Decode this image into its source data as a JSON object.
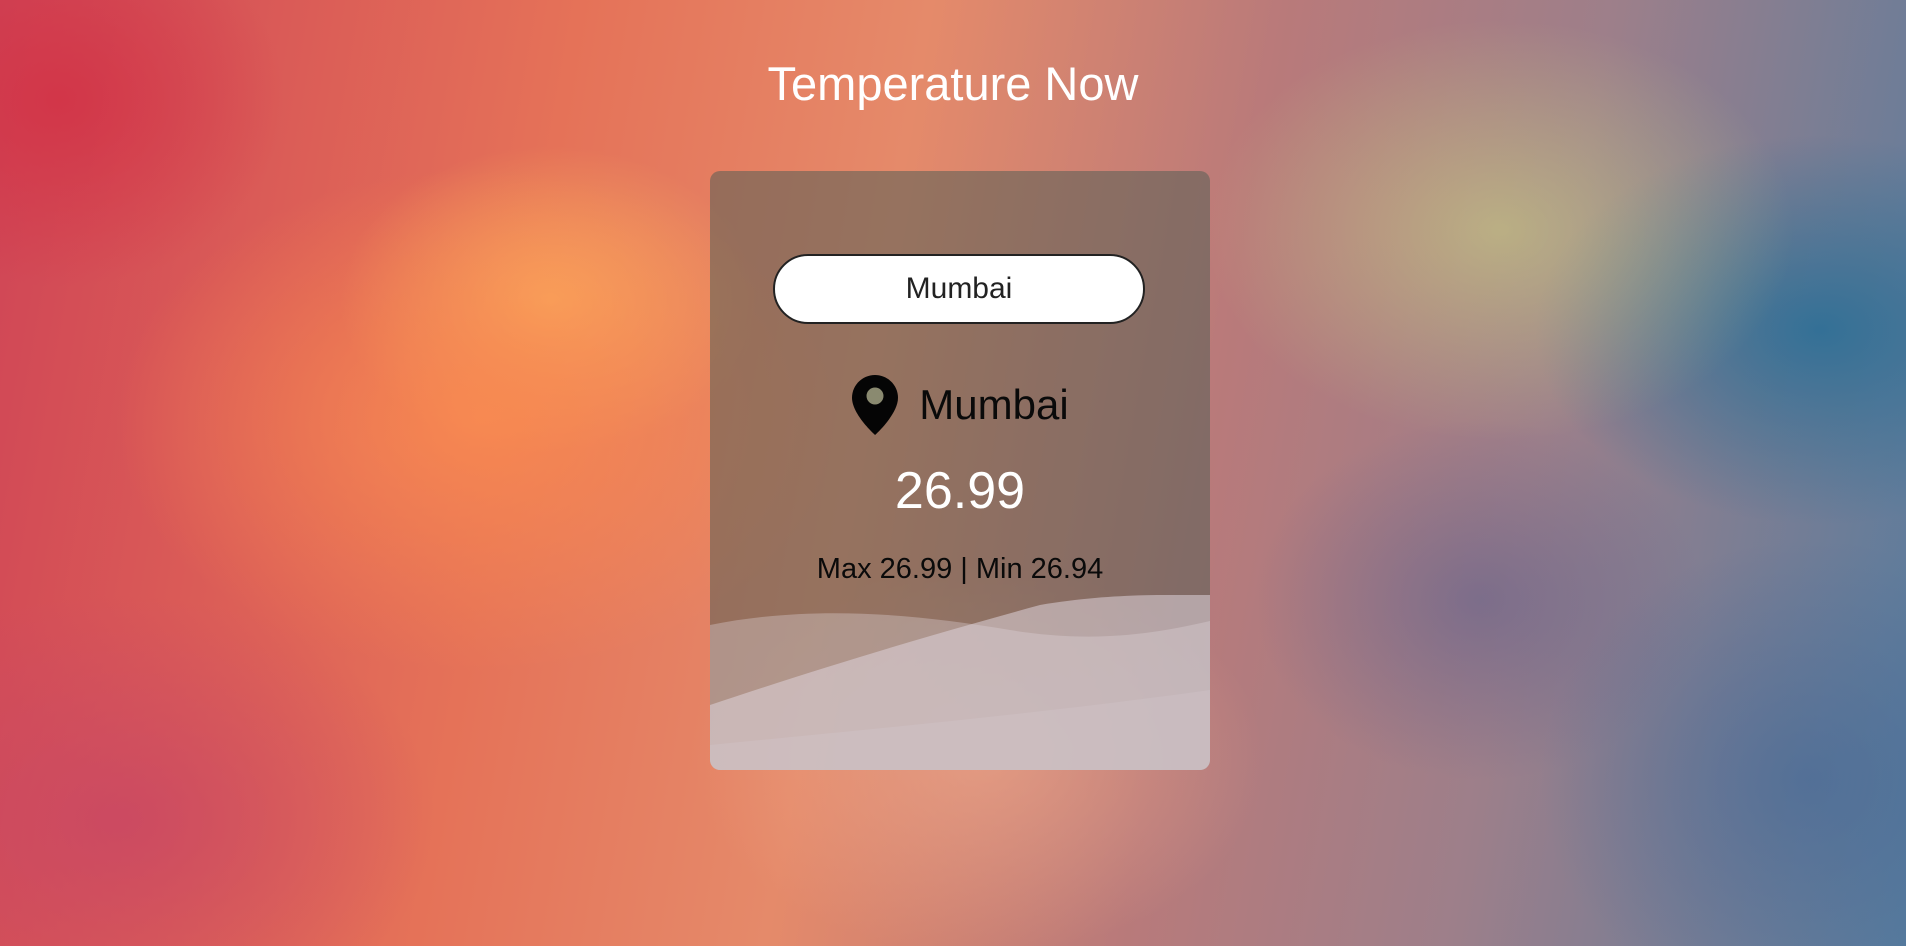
{
  "page": {
    "title": "Temperature Now"
  },
  "search": {
    "value": "Mumbai"
  },
  "weather": {
    "city": "Mumbai",
    "temperature": "26.99",
    "minmax": "Max 26.99 | Min 26.94"
  },
  "icons": {
    "location": "location-pin-icon"
  },
  "colors": {
    "title_text": "#ffffff",
    "card_overlay": "#555f55",
    "search_background": "#ffffff",
    "wave_fill": "#d8d2d6"
  }
}
